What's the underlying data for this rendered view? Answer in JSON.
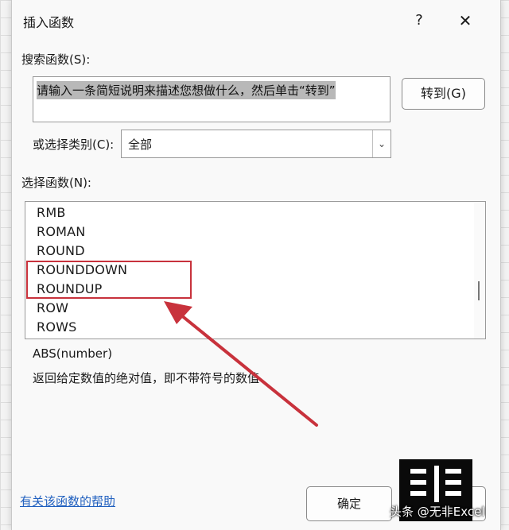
{
  "dialog": {
    "title": "插入函数",
    "help_label": "?",
    "close_label": "✕"
  },
  "search": {
    "label": "搜索函数(S):",
    "value": "请输入一条简短说明来描述您想做什么，然后单击“转到”",
    "goto_label": "转到(G)"
  },
  "category": {
    "label": "或选择类别(C):",
    "value": "全部"
  },
  "functions": {
    "label": "选择函数(N):",
    "items": [
      "RMB",
      "ROMAN",
      "ROUND",
      "ROUNDDOWN",
      "ROUNDUP",
      "ROW",
      "ROWS"
    ],
    "highlighted": [
      "ROUNDDOWN",
      "ROUNDUP"
    ]
  },
  "selected_function": {
    "signature": "ABS(number)",
    "description": "返回给定数值的绝对值，即不带符号的数值"
  },
  "footer": {
    "help_link": "有关该函数的帮助",
    "ok_label": "确定"
  },
  "watermark": {
    "text": "头条 @无非Excel"
  },
  "colors": {
    "annotation": "#c8323c",
    "link": "#1f5fbf"
  },
  "icons": {
    "dropdown": "chevron-down-icon",
    "close": "close-icon"
  }
}
